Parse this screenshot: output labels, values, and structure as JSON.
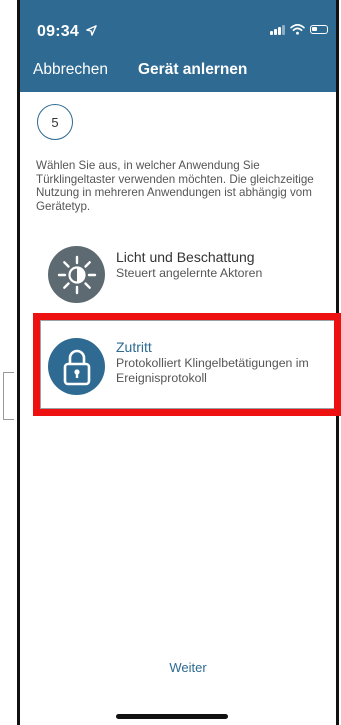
{
  "status_bar": {
    "time": "09:34",
    "location_icon": "location-arrow-icon",
    "signal_icon": "cellular-signal-icon",
    "wifi_icon": "wifi-icon",
    "battery_icon": "battery-icon"
  },
  "nav": {
    "cancel_label": "Abbrechen",
    "title": "Gerät anlernen"
  },
  "step": {
    "number": "5"
  },
  "instruction": "Wählen Sie aus, in welcher Anwendung Sie Türklingeltaster verwenden möchten. Die gleichzeitige Nutzung in mehreren Anwendungen ist abhängig vom Gerätetyp.",
  "options": [
    {
      "title": "Licht und Beschattung",
      "subtitle": "Steuert angelernte Aktoren",
      "icon": "sun-half-icon"
    },
    {
      "title": "Zutritt",
      "subtitle": "Protokolliert Klingelbetätigungen im Ereignisprotokoll",
      "icon": "padlock-icon"
    }
  ],
  "footer": {
    "next_label": "Weiter"
  },
  "colors": {
    "brand_blue": "#2e6a92",
    "highlight_red": "#ee1111",
    "icon_gray": "#5e6a72"
  }
}
